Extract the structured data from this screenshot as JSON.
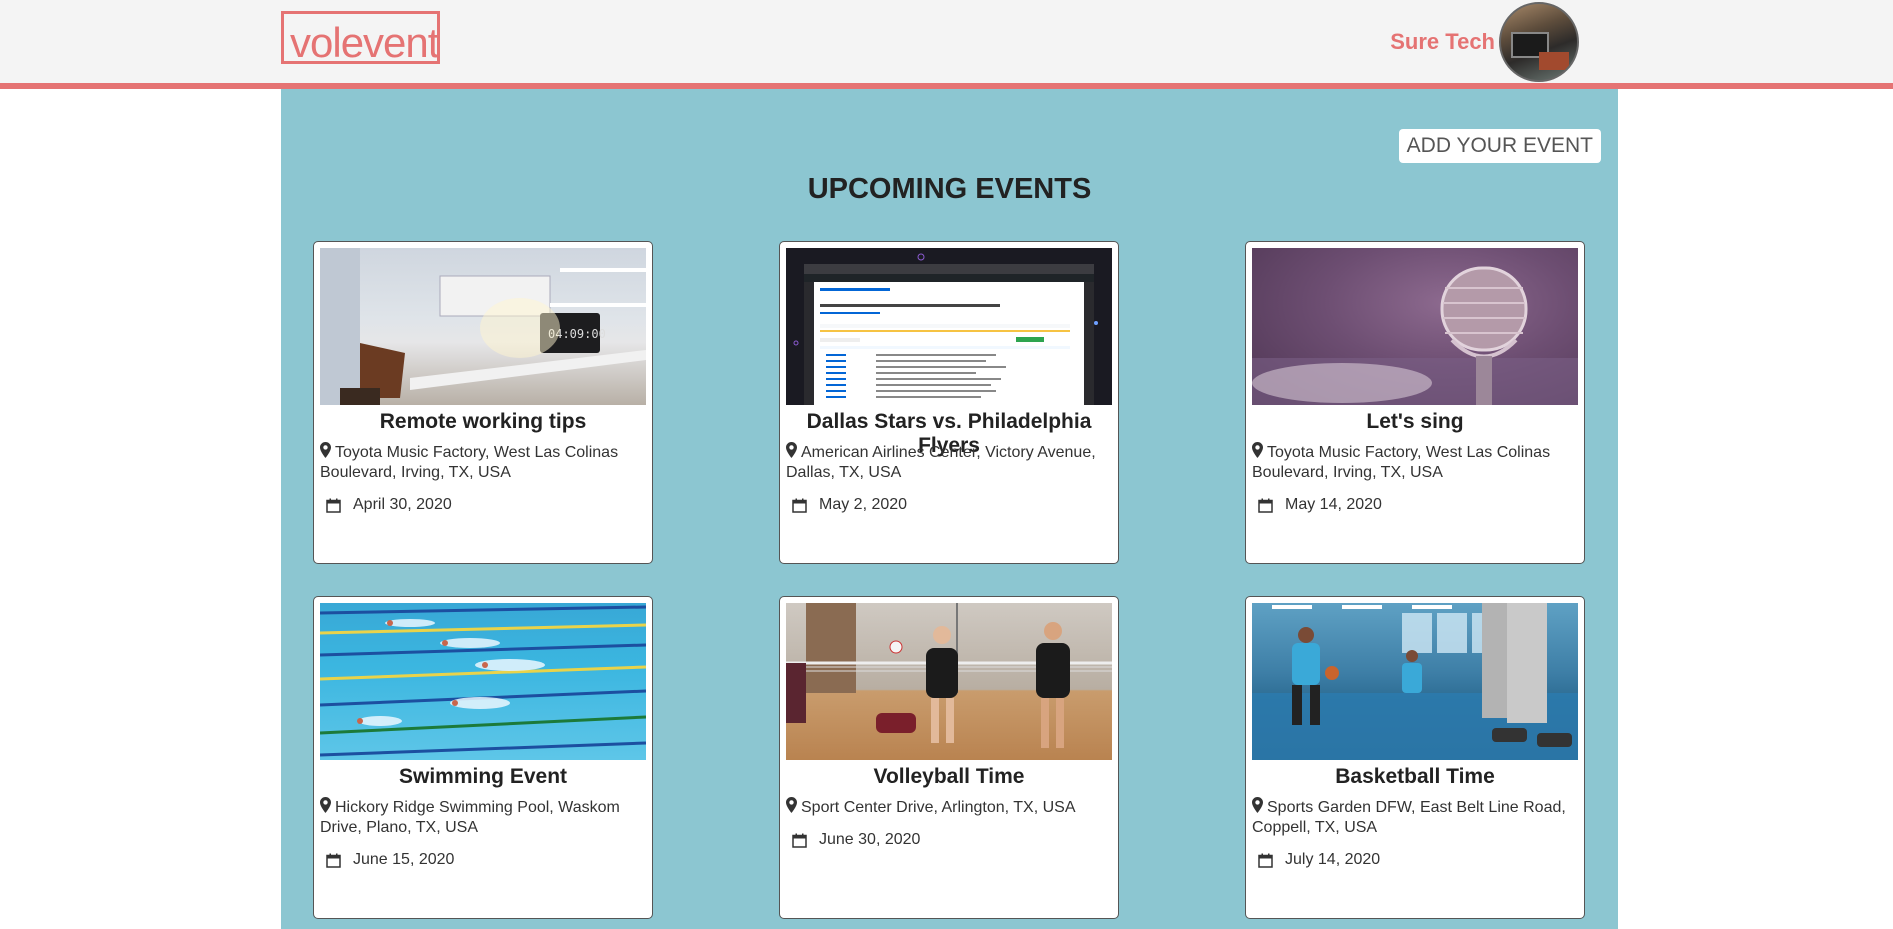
{
  "header": {
    "logo": "volevent",
    "user_name": "Sure Tech"
  },
  "main": {
    "add_event_label": "ADD YOUR EVENT",
    "title": "UPCOMING EVENTS"
  },
  "events": [
    {
      "title": "Remote working tips",
      "location": "Toyota Music Factory, West Las Colinas Boulevard, Irving, TX, USA",
      "date": "April 30, 2020",
      "image": "desk-workspace"
    },
    {
      "title": "Dallas Stars vs. Philadelphia Flyers",
      "location": "American Airlines Center, Victory Avenue, Dallas, TX, USA",
      "date": "May 2, 2020",
      "image": "github-screenshot"
    },
    {
      "title": "Let's sing",
      "location": "Toyota Music Factory, West Las Colinas Boulevard, Irving, TX, USA",
      "date": "May 14, 2020",
      "image": "microphone"
    },
    {
      "title": "Swimming Event",
      "location": "Hickory Ridge Swimming Pool, Waskom Drive, Plano, TX, USA",
      "date": "June 15, 2020",
      "image": "swimming-pool"
    },
    {
      "title": "Volleyball Time",
      "location": "Sport Center Drive, Arlington, TX, USA",
      "date": "June 30, 2020",
      "image": "volleyball"
    },
    {
      "title": "Basketball Time",
      "location": "Sports Garden DFW, East Belt Line Road, Coppell, TX, USA",
      "date": "July 14, 2020",
      "image": "basketball"
    }
  ],
  "colors": {
    "accent": "#e57373",
    "main_bg": "#8cc6d1",
    "header_bg": "#f4f4f4"
  }
}
